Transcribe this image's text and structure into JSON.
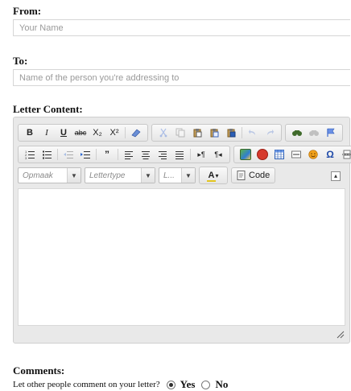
{
  "from": {
    "label": "From:",
    "placeholder": "Your Name",
    "value": ""
  },
  "to": {
    "label": "To:",
    "placeholder": "Name of the person you're addressing to",
    "value": ""
  },
  "letter": {
    "label": "Letter Content:",
    "toolbar": {
      "row1": {
        "bold": "B",
        "italic": "I",
        "underline": "U",
        "strike": "abc",
        "subscript": "X₂",
        "superscript": "X²"
      },
      "row3": {
        "format_combo": "Opmaak",
        "font_combo": "Lettertype",
        "size_combo": "L...",
        "text_color": "A",
        "source_button": "Code"
      }
    }
  },
  "comments": {
    "label": "Comments:",
    "question": "Let other people comment on your letter?",
    "yes": "Yes",
    "no": "No",
    "selected": "Yes"
  }
}
